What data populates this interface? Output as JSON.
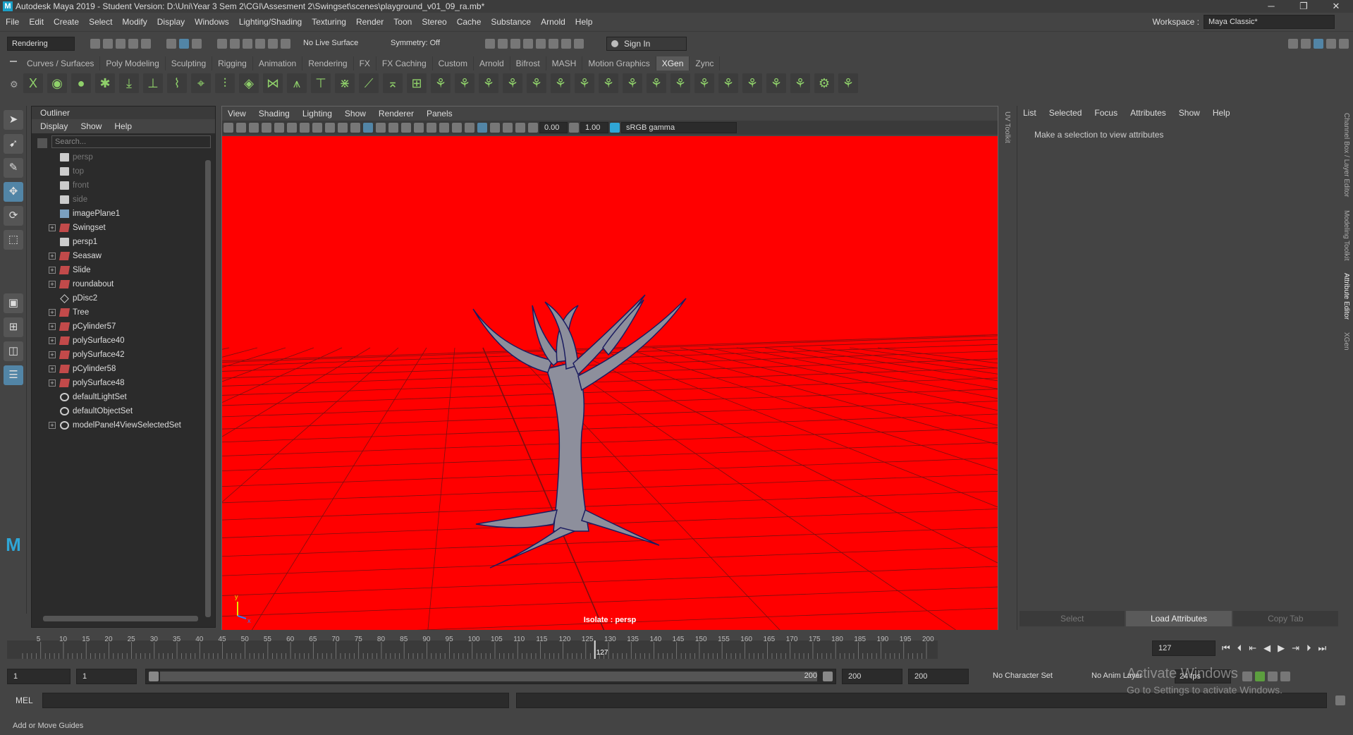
{
  "title_bar": {
    "logo": "M",
    "title": "Autodesk Maya 2019 - Student Version: D:\\Uni\\Year 3 Sem 2\\CGI\\Assesment 2\\Swingset\\scenes\\playground_v01_09_ra.mb*",
    "minimize": "─",
    "maximize": "❐",
    "close": "✕"
  },
  "menu_bar": {
    "items": [
      "File",
      "Edit",
      "Create",
      "Select",
      "Modify",
      "Display",
      "Windows",
      "Lighting/Shading",
      "Texturing",
      "Render",
      "Toon",
      "Stereo",
      "Cache",
      "Substance",
      "Arnold",
      "Help"
    ],
    "workspace_label": "Workspace :",
    "workspace_value": "Maya Classic*"
  },
  "status_line": {
    "menu_set": "Rendering",
    "live_surface": "No Live Surface",
    "symmetry": "Symmetry: Off",
    "sign_in": "Sign In"
  },
  "shelf": {
    "tabs": [
      "Curves / Surfaces",
      "Poly Modeling",
      "Sculpting",
      "Rigging",
      "Animation",
      "Rendering",
      "FX",
      "FX Caching",
      "Custom",
      "Arnold",
      "Bifrost",
      "MASH",
      "Motion Graphics",
      "XGen",
      "Zync"
    ],
    "active_tab": "XGen",
    "icons": [
      "X",
      "◉",
      "●",
      "✱",
      "⤓",
      "⊥",
      "⌇",
      "⌖",
      "⫶",
      "◈",
      "⋈",
      "⩚",
      "⊤",
      "⋇",
      "⟋",
      "⌅",
      "⊞",
      "⚘",
      "⚘",
      "⚘",
      "⚘",
      "⚘",
      "⚘",
      "⚘",
      "⚘",
      "⚘",
      "⚘",
      "⚘",
      "⚘",
      "⚘",
      "⚘",
      "⚘",
      "⚘",
      "⚙",
      "⚘"
    ]
  },
  "outliner": {
    "title": "Outliner",
    "menu": [
      "Display",
      "Show",
      "Help"
    ],
    "search_placeholder": "Search...",
    "items": [
      {
        "label": "persp",
        "icon": "cam",
        "dim": true,
        "expand": false
      },
      {
        "label": "top",
        "icon": "cam",
        "dim": true,
        "expand": false
      },
      {
        "label": "front",
        "icon": "cam",
        "dim": true,
        "expand": false
      },
      {
        "label": "side",
        "icon": "cam",
        "dim": true,
        "expand": false
      },
      {
        "label": "imagePlane1",
        "icon": "plane",
        "dim": false,
        "expand": false
      },
      {
        "label": "Swingset",
        "icon": "mesh",
        "dim": false,
        "expand": true
      },
      {
        "label": "persp1",
        "icon": "cam",
        "dim": false,
        "expand": false
      },
      {
        "label": "Seasaw",
        "icon": "mesh",
        "dim": false,
        "expand": true
      },
      {
        "label": "Slide",
        "icon": "mesh",
        "dim": false,
        "expand": true
      },
      {
        "label": "roundabout",
        "icon": "mesh",
        "dim": false,
        "expand": true
      },
      {
        "label": "pDisc2",
        "icon": "loc",
        "dim": false,
        "expand": false
      },
      {
        "label": "Tree",
        "icon": "mesh",
        "dim": false,
        "expand": true
      },
      {
        "label": "pCylinder57",
        "icon": "mesh",
        "dim": false,
        "expand": true
      },
      {
        "label": "polySurface40",
        "icon": "mesh",
        "dim": false,
        "expand": true
      },
      {
        "label": "polySurface42",
        "icon": "mesh",
        "dim": false,
        "expand": true
      },
      {
        "label": "pCylinder58",
        "icon": "mesh",
        "dim": false,
        "expand": true
      },
      {
        "label": "polySurface48",
        "icon": "mesh",
        "dim": false,
        "expand": true
      },
      {
        "label": "defaultLightSet",
        "icon": "set",
        "dim": false,
        "expand": false
      },
      {
        "label": "defaultObjectSet",
        "icon": "set",
        "dim": false,
        "expand": false
      },
      {
        "label": "modelPanel4ViewSelectedSet",
        "icon": "set",
        "dim": false,
        "expand": true
      }
    ]
  },
  "viewport": {
    "menu": [
      "View",
      "Shading",
      "Lighting",
      "Show",
      "Renderer",
      "Panels"
    ],
    "exposure": "0.00",
    "gamma": "1.00",
    "color_space": "sRGB gamma",
    "isolate_label": "Isolate : persp",
    "background_color": "#ff0000",
    "axis_y": "y",
    "axis_x": "x"
  },
  "side_panel": {
    "uv_toolkit": "UV Toolkit",
    "menu": [
      "List",
      "Selected",
      "Focus",
      "Attributes",
      "Show",
      "Help"
    ],
    "message": "Make a selection to view attributes",
    "buttons": [
      "Select",
      "Load Attributes",
      "Copy Tab"
    ],
    "vertical_tabs": [
      "Channel Box / Layer Editor",
      "Modeling Toolkit",
      "Attribute Editor",
      "XGen"
    ]
  },
  "time_slider": {
    "ticks": [
      "5",
      "10",
      "15",
      "20",
      "25",
      "30",
      "35",
      "40",
      "45",
      "50",
      "55",
      "60",
      "65",
      "70",
      "75",
      "80",
      "85",
      "90",
      "95",
      "100",
      "105",
      "110",
      "115",
      "120",
      "125",
      "130",
      "135",
      "140",
      "145",
      "150",
      "155",
      "160",
      "165",
      "170",
      "175",
      "180",
      "185",
      "190",
      "195",
      "200"
    ],
    "current_frame_marker": "127",
    "current_frame_field": "127",
    "current_frame": 127,
    "range_max": 200
  },
  "range_slider": {
    "start": "1",
    "playback_start": "1",
    "bar_start": "1",
    "bar_end": "200",
    "playback_end": "200",
    "end": "200",
    "character_set": "No Character Set",
    "anim_layer": "No Anim Layer",
    "fps": "24 fps"
  },
  "command_line": {
    "label": "MEL"
  },
  "help_line": {
    "text": "Add or Move Guides"
  },
  "watermark": {
    "line1": "Activate Windows",
    "line2": "Go to Settings to activate Windows."
  }
}
